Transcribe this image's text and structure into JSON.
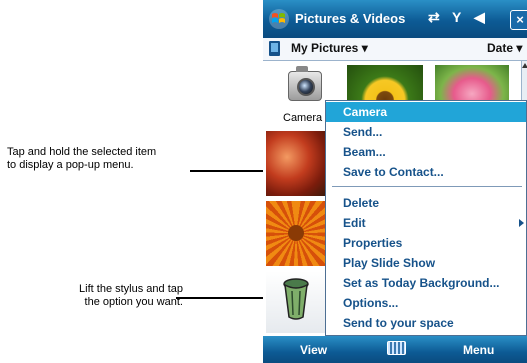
{
  "callouts": [
    "Tap and hold the selected item\nto display a pop-up menu.",
    "Lift the stylus and tap\nthe option you want."
  ],
  "titlebar": {
    "title": "Pictures & Videos",
    "icons": [
      "start-logo-icon",
      "connectivity-icon",
      "signal-icon",
      "volume-icon",
      "close-icon"
    ],
    "close_label": "×"
  },
  "folderbar": {
    "folder": "My Pictures ▾",
    "sort": "Date ▾"
  },
  "thumbnails": {
    "camera_label": "Camera"
  },
  "menu": {
    "items": [
      {
        "label": "Camera",
        "selected": true
      },
      {
        "label": "Send..."
      },
      {
        "label": "Beam..."
      },
      {
        "label": "Save to Contact..."
      },
      {
        "label": "Delete"
      },
      {
        "label": "Edit",
        "has_submenu": true
      },
      {
        "label": "Properties"
      },
      {
        "label": "Play Slide Show"
      },
      {
        "label": "Set as Today Background..."
      },
      {
        "label": "Options..."
      },
      {
        "label": "Send to your space"
      }
    ]
  },
  "softkeys": {
    "left": "View",
    "right": "Menu",
    "center_icon": "keyboard-icon"
  },
  "colors": {
    "titlebar": "#0d5b95",
    "menu_highlight": "#21a5d8",
    "menu_text": "#16528a"
  }
}
